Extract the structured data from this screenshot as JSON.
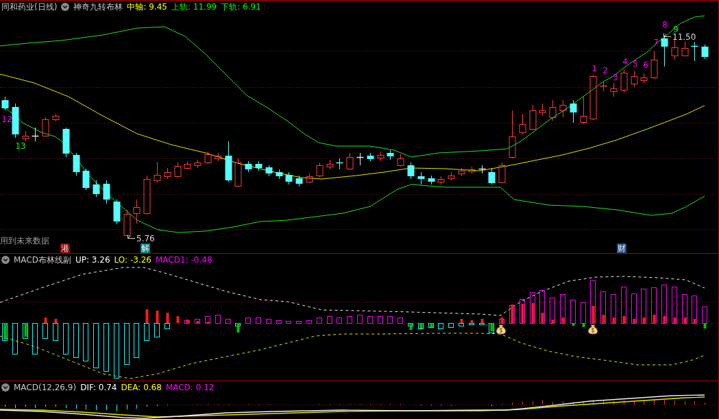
{
  "main_chart": {
    "title": "同和药业(日线)",
    "indicator": "神奇九转布林",
    "readings": [
      {
        "label": "中轴: 9.45",
        "color": "#ffff00"
      },
      {
        "label": "上轨: 11.99",
        "color": "#00ff00"
      },
      {
        "label": "下轨: 6.91",
        "color": "#00ff00"
      }
    ],
    "count_labels": [
      {
        "text": "12",
        "color": "#ff00ff"
      },
      {
        "text": "13",
        "color": "#00ff00"
      },
      {
        "text": "1",
        "color": "#ff00ff"
      },
      {
        "text": "2",
        "color": "#ff00ff"
      },
      {
        "text": "3",
        "color": "#ff00ff"
      },
      {
        "text": "4",
        "color": "#ff00ff"
      },
      {
        "text": "5",
        "color": "#ff00ff"
      },
      {
        "text": "6",
        "color": "#ff00ff"
      },
      {
        "text": "7",
        "color": "#ff00ff"
      },
      {
        "text": "8",
        "color": "#ff00ff"
      },
      {
        "text": "9",
        "color": "#00ff00"
      }
    ],
    "price_labels": [
      "11.50",
      "5.76"
    ],
    "notice": "用到未来数据",
    "event_badges": [
      {
        "text": "港",
        "color": "#8b0000"
      },
      {
        "text": "解",
        "color": "#008080"
      },
      {
        "text": "财",
        "color": "#1e4f8c"
      }
    ]
  },
  "macd_boll_panel": {
    "title": "MACD布林线副",
    "readings": [
      {
        "label": "UP: 3.26",
        "color": "#ffffff"
      },
      {
        "label": "LO: -3.26",
        "color": "#ffff00"
      },
      {
        "label": "MACD1: -0.48",
        "color": "#ff00ff"
      }
    ]
  },
  "macd_panel": {
    "title": "MACD(12,26,9)",
    "readings": [
      {
        "label": "DIF: 0.74",
        "color": "#ffffff"
      },
      {
        "label": "DEA: 0.68",
        "color": "#ffff00"
      },
      {
        "label": "MACD: 0.12",
        "color": "#ff00ff"
      }
    ]
  }
}
